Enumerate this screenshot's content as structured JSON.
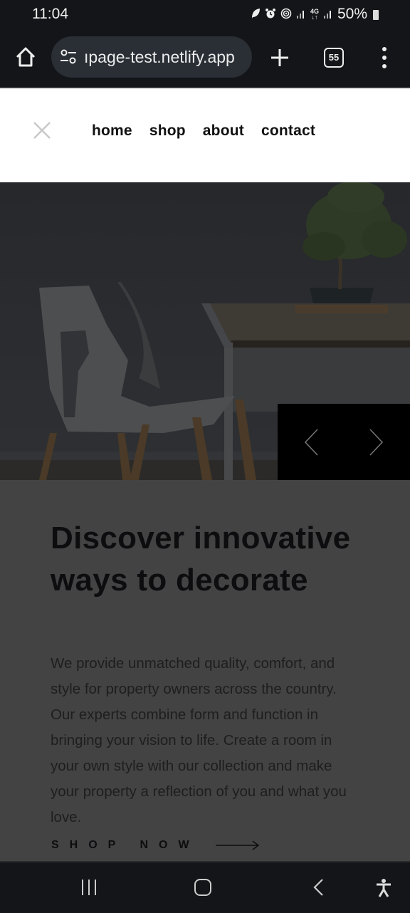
{
  "status_bar": {
    "time": "11:04",
    "icons": [
      "leaf-icon",
      "alarm-icon",
      "hotspot-icon",
      "signal-icon",
      "4g-icon",
      "signal-icon"
    ],
    "network_label": "4G",
    "battery": "50%"
  },
  "browser": {
    "url": "ıpage-test.netlify.app",
    "tab_count": "55"
  },
  "site_nav": {
    "items": [
      {
        "label": "home"
      },
      {
        "label": "shop"
      },
      {
        "label": "about"
      },
      {
        "label": "contact"
      }
    ]
  },
  "hero": {
    "image_alt": "White chair beside a wooden table with a bonsai tree"
  },
  "content": {
    "headline": "Discover innovative ways to decorate",
    "description": "We provide unmatched quality, comfort, and style for property owners across the country. Our experts combine form and function in bringing your vision to life. Create a room in your own style with our collection and make your property a reflection of you and what you love.",
    "cta_label": "SHOP NOW"
  },
  "colors": {
    "page_overlay": "#434343",
    "header_bg": "#ffffff",
    "slider_bg": "#000000",
    "browser_chrome": "#141518"
  }
}
